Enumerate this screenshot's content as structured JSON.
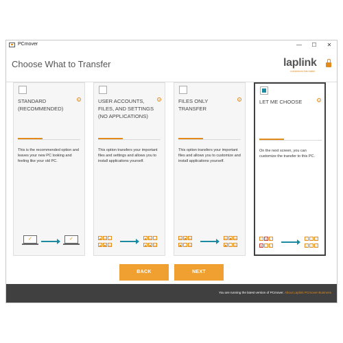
{
  "window": {
    "title": "PCmover",
    "controls": {
      "minimize": "—",
      "maximize": "☐",
      "close": "✕"
    }
  },
  "header": {
    "page_title": "Choose What to Transfer",
    "logo_text": "laplink",
    "logo_tagline": "connections that matter"
  },
  "cards": [
    {
      "title": "STANDARD (RECOMMENDED)",
      "checked": false,
      "info": "?",
      "description": "This is the recommended option and leaves your new PC looking and feeling like your old PC.",
      "illustration": "laptop-to-laptop"
    },
    {
      "title": "USER ACCOUNTS, FILES, AND SETTINGS (NO APPLICATIONS)",
      "checked": false,
      "info": "?",
      "description": "This option transfers your important files and settings and allows you to install applications yourself.",
      "illustration": "files-to-files"
    },
    {
      "title": "FILES ONLY TRANSFER",
      "checked": false,
      "info": "?",
      "description": "This option transfers your important files and allows you to customize and install applications yourself.",
      "illustration": "files-to-files"
    },
    {
      "title": "LET ME CHOOSE",
      "checked": true,
      "info": "?",
      "description": "On the next screen, you can customize the transfer to this PC.",
      "illustration": "checklist-to-checklist"
    }
  ],
  "buttons": {
    "back": "BACK",
    "next": "NEXT"
  },
  "footer": {
    "status_text": "You are running the latest version of PCmover.",
    "link_text": "About Laplink PCmover Business"
  },
  "colors": {
    "accent": "#e28a1b",
    "button": "#f0a030",
    "teal": "#1c8aa0",
    "footer": "#404040"
  }
}
